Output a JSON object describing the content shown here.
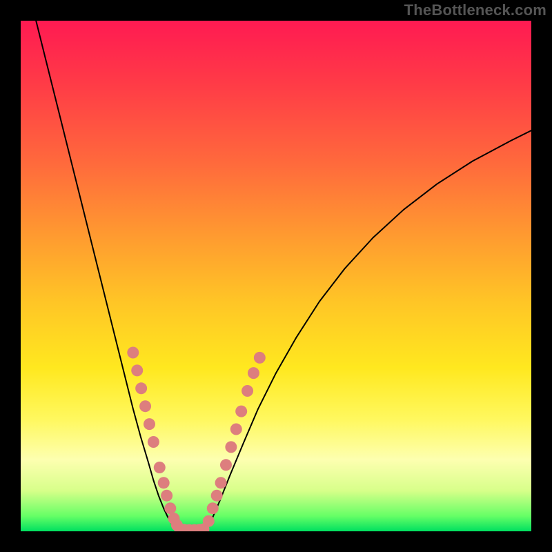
{
  "watermark": "TheBottleneck.com",
  "chart_data": {
    "type": "line",
    "title": "",
    "xlabel": "",
    "ylabel": "",
    "xlim": [
      0,
      100
    ],
    "ylim": [
      0,
      100
    ],
    "grid": false,
    "legend": false,
    "series": [
      {
        "name": "curve-left",
        "stroke": "#000000",
        "x": [
          3,
          5,
          7,
          9,
          11,
          13,
          15,
          17,
          19,
          20.5,
          22,
          23.5,
          25,
          26,
          27,
          28,
          28.8,
          29.5,
          30.2,
          31
        ],
        "y": [
          100,
          92,
          84,
          76,
          68,
          60,
          52,
          44,
          36,
          30,
          24,
          18.5,
          13.5,
          10,
          7,
          4.5,
          2.8,
          1.6,
          0.8,
          0.2
        ]
      },
      {
        "name": "notch-floor",
        "stroke": "#000000",
        "x": [
          31,
          32,
          33,
          34,
          35,
          36.2
        ],
        "y": [
          0.2,
          0.1,
          0.1,
          0.1,
          0.1,
          0.2
        ]
      },
      {
        "name": "curve-right",
        "stroke": "#000000",
        "x": [
          36.2,
          37.5,
          39,
          41,
          43.5,
          46.5,
          50,
          54,
          58.5,
          63.5,
          69,
          75,
          81.5,
          88.5,
          96,
          100
        ],
        "y": [
          0.2,
          2.5,
          6,
          11,
          17,
          24,
          31,
          38,
          45,
          51.5,
          57.5,
          63,
          68,
          72.5,
          76.5,
          78.5
        ]
      }
    ],
    "markers": [
      {
        "name": "dots-left-branch",
        "color": "#dd7e7e",
        "points": [
          {
            "x": 22.0,
            "y": 35.0
          },
          {
            "x": 22.8,
            "y": 31.5
          },
          {
            "x": 23.6,
            "y": 28.0
          },
          {
            "x": 24.4,
            "y": 24.5
          },
          {
            "x": 25.2,
            "y": 21.0
          },
          {
            "x": 26.0,
            "y": 17.5
          },
          {
            "x": 27.2,
            "y": 12.5
          },
          {
            "x": 28.0,
            "y": 9.5
          },
          {
            "x": 28.6,
            "y": 7.0
          },
          {
            "x": 29.3,
            "y": 4.5
          },
          {
            "x": 30.0,
            "y": 2.5
          },
          {
            "x": 30.6,
            "y": 1.2
          }
        ]
      },
      {
        "name": "dots-floor",
        "color": "#dd7e7e",
        "points": [
          {
            "x": 31.2,
            "y": 0.4
          },
          {
            "x": 32.0,
            "y": 0.3
          },
          {
            "x": 33.0,
            "y": 0.25
          },
          {
            "x": 34.0,
            "y": 0.25
          },
          {
            "x": 35.0,
            "y": 0.3
          },
          {
            "x": 35.8,
            "y": 0.4
          }
        ]
      },
      {
        "name": "dots-right-branch",
        "color": "#dd7e7e",
        "points": [
          {
            "x": 36.8,
            "y": 2.0
          },
          {
            "x": 37.6,
            "y": 4.5
          },
          {
            "x": 38.4,
            "y": 7.0
          },
          {
            "x": 39.2,
            "y": 9.5
          },
          {
            "x": 40.2,
            "y": 13.0
          },
          {
            "x": 41.2,
            "y": 16.5
          },
          {
            "x": 42.2,
            "y": 20.0
          },
          {
            "x": 43.2,
            "y": 23.5
          },
          {
            "x": 44.4,
            "y": 27.5
          },
          {
            "x": 45.6,
            "y": 31.0
          },
          {
            "x": 46.8,
            "y": 34.0
          }
        ]
      }
    ],
    "gradient_stops": [
      {
        "pos": 0.0,
        "color": "#ff1a52"
      },
      {
        "pos": 0.28,
        "color": "#ff6a3c"
      },
      {
        "pos": 0.55,
        "color": "#ffc526"
      },
      {
        "pos": 0.78,
        "color": "#fff85e"
      },
      {
        "pos": 0.92,
        "color": "#d8ff8a"
      },
      {
        "pos": 1.0,
        "color": "#00e060"
      }
    ]
  }
}
